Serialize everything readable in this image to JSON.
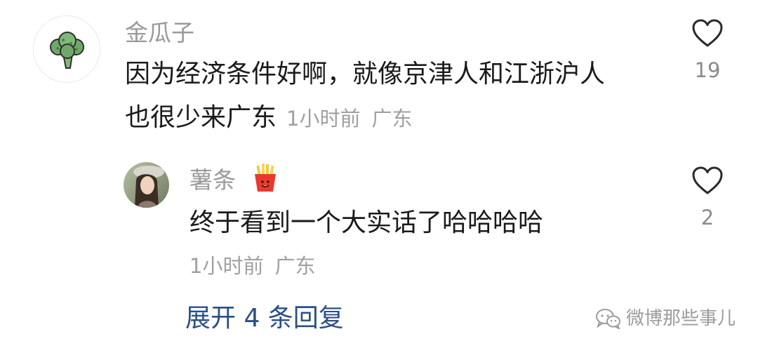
{
  "comment": {
    "username": "金瓜子",
    "avatar_icon": "broccoli-icon",
    "text_line1": "因为经济条件好啊，就像京津人和江浙沪人",
    "text_line2": "也很少来广东",
    "time": "1小时前",
    "location": "广东",
    "like_icon": "heart-outline-icon",
    "like_count": "19"
  },
  "reply": {
    "username": "薯条",
    "badge_icon": "french-fries-icon",
    "avatar_icon": "user-photo-avatar",
    "text": "终于看到一个大实话了哈哈哈哈",
    "time": "1小时前",
    "location": "广东",
    "like_icon": "heart-outline-icon",
    "like_count": "2"
  },
  "expand_replies": {
    "label": "展开 4 条回复"
  },
  "watermark": {
    "icon": "wechat-icon",
    "text": "微博那些事儿"
  },
  "colors": {
    "text_primary": "#1a1a1a",
    "text_secondary": "#9a9a9a",
    "link": "#2b4f86",
    "broccoli": "#6fa96a"
  }
}
